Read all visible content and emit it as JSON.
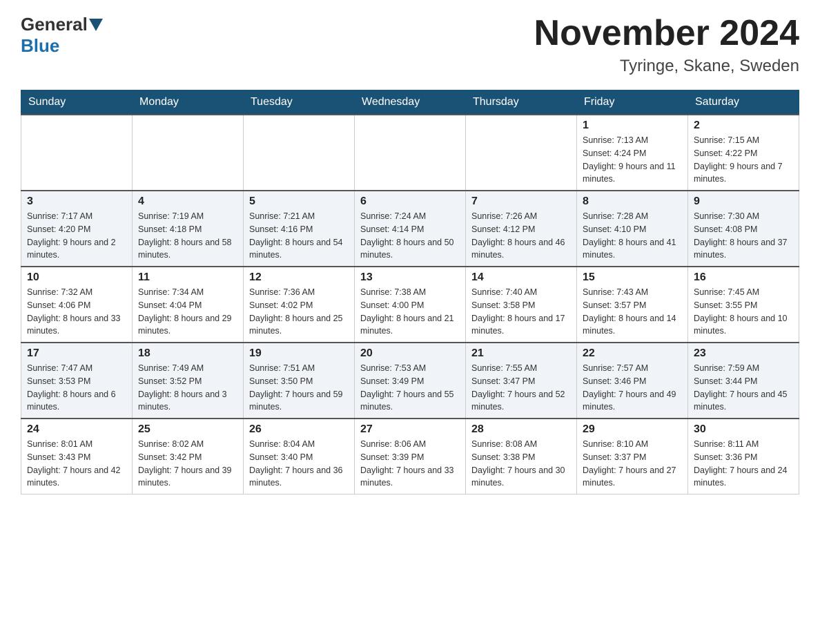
{
  "logo": {
    "general": "General",
    "blue": "Blue"
  },
  "title": "November 2024",
  "location": "Tyringe, Skane, Sweden",
  "weekdays": [
    "Sunday",
    "Monday",
    "Tuesday",
    "Wednesday",
    "Thursday",
    "Friday",
    "Saturday"
  ],
  "weeks": [
    [
      {
        "day": "",
        "sunrise": "",
        "sunset": "",
        "daylight": ""
      },
      {
        "day": "",
        "sunrise": "",
        "sunset": "",
        "daylight": ""
      },
      {
        "day": "",
        "sunrise": "",
        "sunset": "",
        "daylight": ""
      },
      {
        "day": "",
        "sunrise": "",
        "sunset": "",
        "daylight": ""
      },
      {
        "day": "",
        "sunrise": "",
        "sunset": "",
        "daylight": ""
      },
      {
        "day": "1",
        "sunrise": "Sunrise: 7:13 AM",
        "sunset": "Sunset: 4:24 PM",
        "daylight": "Daylight: 9 hours and 11 minutes."
      },
      {
        "day": "2",
        "sunrise": "Sunrise: 7:15 AM",
        "sunset": "Sunset: 4:22 PM",
        "daylight": "Daylight: 9 hours and 7 minutes."
      }
    ],
    [
      {
        "day": "3",
        "sunrise": "Sunrise: 7:17 AM",
        "sunset": "Sunset: 4:20 PM",
        "daylight": "Daylight: 9 hours and 2 minutes."
      },
      {
        "day": "4",
        "sunrise": "Sunrise: 7:19 AM",
        "sunset": "Sunset: 4:18 PM",
        "daylight": "Daylight: 8 hours and 58 minutes."
      },
      {
        "day": "5",
        "sunrise": "Sunrise: 7:21 AM",
        "sunset": "Sunset: 4:16 PM",
        "daylight": "Daylight: 8 hours and 54 minutes."
      },
      {
        "day": "6",
        "sunrise": "Sunrise: 7:24 AM",
        "sunset": "Sunset: 4:14 PM",
        "daylight": "Daylight: 8 hours and 50 minutes."
      },
      {
        "day": "7",
        "sunrise": "Sunrise: 7:26 AM",
        "sunset": "Sunset: 4:12 PM",
        "daylight": "Daylight: 8 hours and 46 minutes."
      },
      {
        "day": "8",
        "sunrise": "Sunrise: 7:28 AM",
        "sunset": "Sunset: 4:10 PM",
        "daylight": "Daylight: 8 hours and 41 minutes."
      },
      {
        "day": "9",
        "sunrise": "Sunrise: 7:30 AM",
        "sunset": "Sunset: 4:08 PM",
        "daylight": "Daylight: 8 hours and 37 minutes."
      }
    ],
    [
      {
        "day": "10",
        "sunrise": "Sunrise: 7:32 AM",
        "sunset": "Sunset: 4:06 PM",
        "daylight": "Daylight: 8 hours and 33 minutes."
      },
      {
        "day": "11",
        "sunrise": "Sunrise: 7:34 AM",
        "sunset": "Sunset: 4:04 PM",
        "daylight": "Daylight: 8 hours and 29 minutes."
      },
      {
        "day": "12",
        "sunrise": "Sunrise: 7:36 AM",
        "sunset": "Sunset: 4:02 PM",
        "daylight": "Daylight: 8 hours and 25 minutes."
      },
      {
        "day": "13",
        "sunrise": "Sunrise: 7:38 AM",
        "sunset": "Sunset: 4:00 PM",
        "daylight": "Daylight: 8 hours and 21 minutes."
      },
      {
        "day": "14",
        "sunrise": "Sunrise: 7:40 AM",
        "sunset": "Sunset: 3:58 PM",
        "daylight": "Daylight: 8 hours and 17 minutes."
      },
      {
        "day": "15",
        "sunrise": "Sunrise: 7:43 AM",
        "sunset": "Sunset: 3:57 PM",
        "daylight": "Daylight: 8 hours and 14 minutes."
      },
      {
        "day": "16",
        "sunrise": "Sunrise: 7:45 AM",
        "sunset": "Sunset: 3:55 PM",
        "daylight": "Daylight: 8 hours and 10 minutes."
      }
    ],
    [
      {
        "day": "17",
        "sunrise": "Sunrise: 7:47 AM",
        "sunset": "Sunset: 3:53 PM",
        "daylight": "Daylight: 8 hours and 6 minutes."
      },
      {
        "day": "18",
        "sunrise": "Sunrise: 7:49 AM",
        "sunset": "Sunset: 3:52 PM",
        "daylight": "Daylight: 8 hours and 3 minutes."
      },
      {
        "day": "19",
        "sunrise": "Sunrise: 7:51 AM",
        "sunset": "Sunset: 3:50 PM",
        "daylight": "Daylight: 7 hours and 59 minutes."
      },
      {
        "day": "20",
        "sunrise": "Sunrise: 7:53 AM",
        "sunset": "Sunset: 3:49 PM",
        "daylight": "Daylight: 7 hours and 55 minutes."
      },
      {
        "day": "21",
        "sunrise": "Sunrise: 7:55 AM",
        "sunset": "Sunset: 3:47 PM",
        "daylight": "Daylight: 7 hours and 52 minutes."
      },
      {
        "day": "22",
        "sunrise": "Sunrise: 7:57 AM",
        "sunset": "Sunset: 3:46 PM",
        "daylight": "Daylight: 7 hours and 49 minutes."
      },
      {
        "day": "23",
        "sunrise": "Sunrise: 7:59 AM",
        "sunset": "Sunset: 3:44 PM",
        "daylight": "Daylight: 7 hours and 45 minutes."
      }
    ],
    [
      {
        "day": "24",
        "sunrise": "Sunrise: 8:01 AM",
        "sunset": "Sunset: 3:43 PM",
        "daylight": "Daylight: 7 hours and 42 minutes."
      },
      {
        "day": "25",
        "sunrise": "Sunrise: 8:02 AM",
        "sunset": "Sunset: 3:42 PM",
        "daylight": "Daylight: 7 hours and 39 minutes."
      },
      {
        "day": "26",
        "sunrise": "Sunrise: 8:04 AM",
        "sunset": "Sunset: 3:40 PM",
        "daylight": "Daylight: 7 hours and 36 minutes."
      },
      {
        "day": "27",
        "sunrise": "Sunrise: 8:06 AM",
        "sunset": "Sunset: 3:39 PM",
        "daylight": "Daylight: 7 hours and 33 minutes."
      },
      {
        "day": "28",
        "sunrise": "Sunrise: 8:08 AM",
        "sunset": "Sunset: 3:38 PM",
        "daylight": "Daylight: 7 hours and 30 minutes."
      },
      {
        "day": "29",
        "sunrise": "Sunrise: 8:10 AM",
        "sunset": "Sunset: 3:37 PM",
        "daylight": "Daylight: 7 hours and 27 minutes."
      },
      {
        "day": "30",
        "sunrise": "Sunrise: 8:11 AM",
        "sunset": "Sunset: 3:36 PM",
        "daylight": "Daylight: 7 hours and 24 minutes."
      }
    ]
  ]
}
